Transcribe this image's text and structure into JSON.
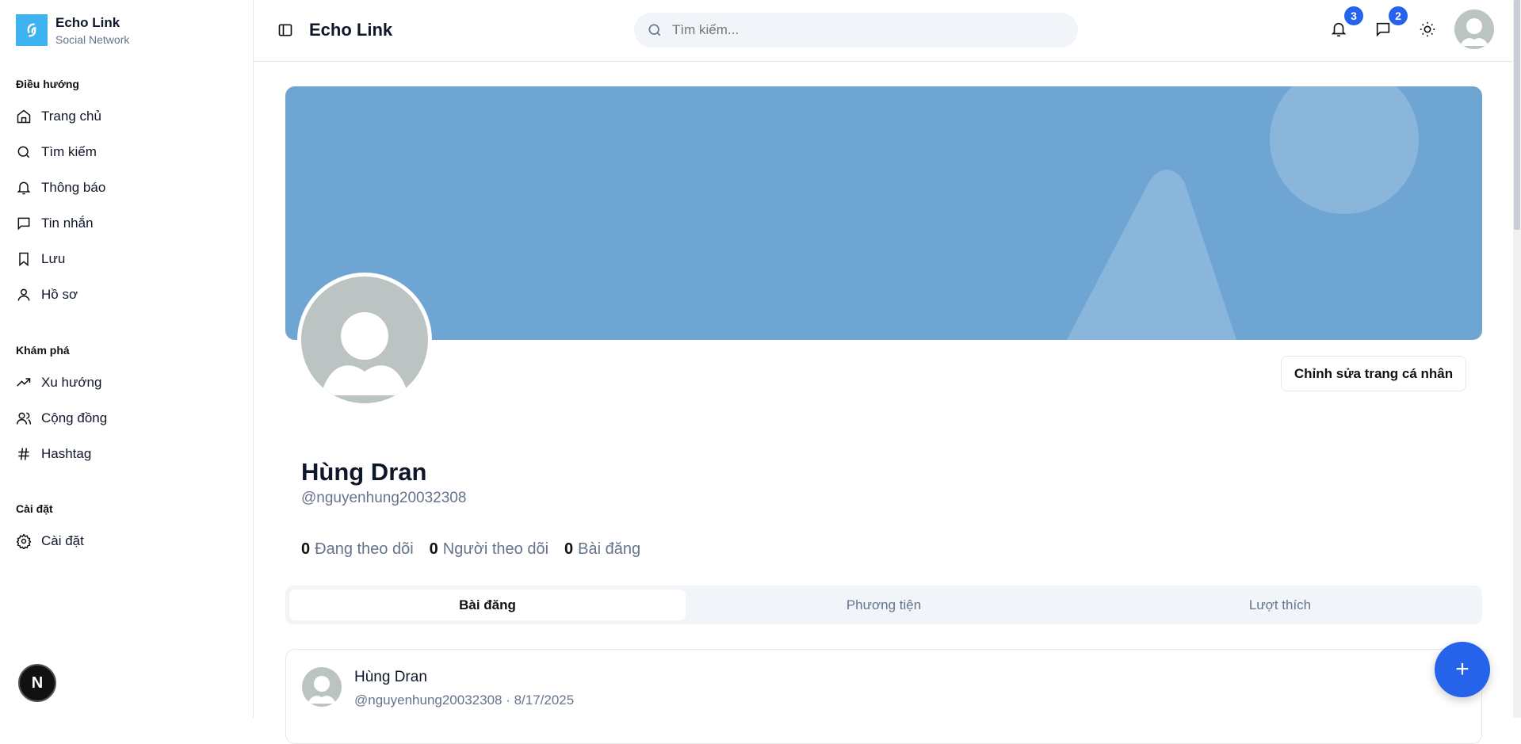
{
  "brand": {
    "title": "Echo Link",
    "subtitle": "Social Network"
  },
  "sidebar": {
    "groups": [
      {
        "label": "Điều hướng",
        "items": [
          {
            "label": "Trang chủ",
            "icon": "home-icon"
          },
          {
            "label": "Tìm kiếm",
            "icon": "search-icon"
          },
          {
            "label": "Thông báo",
            "icon": "bell-icon"
          },
          {
            "label": "Tin nhắn",
            "icon": "message-icon"
          },
          {
            "label": "Lưu",
            "icon": "bookmark-icon"
          },
          {
            "label": "Hồ sơ",
            "icon": "user-icon"
          }
        ]
      },
      {
        "label": "Khám phá",
        "items": [
          {
            "label": "Xu hướng",
            "icon": "trending-icon"
          },
          {
            "label": "Cộng đồng",
            "icon": "users-icon"
          },
          {
            "label": "Hashtag",
            "icon": "hash-icon"
          }
        ]
      },
      {
        "label": "Cài đặt",
        "items": [
          {
            "label": "Cài đặt",
            "icon": "gear-icon"
          }
        ]
      }
    ]
  },
  "header": {
    "title": "Echo Link",
    "search_placeholder": "Tìm kiếm...",
    "notifications_count": "3",
    "messages_count": "2"
  },
  "profile": {
    "name": "Hùng Dran",
    "handle": "@nguyenhung20032308",
    "edit_label": "Chỉnh sửa trang cá nhân",
    "stats": [
      {
        "value": "0",
        "label": "Đang theo dõi"
      },
      {
        "value": "0",
        "label": "Người theo dõi"
      },
      {
        "value": "0",
        "label": "Bài đăng"
      }
    ]
  },
  "tabs": [
    "Bài đăng",
    "Phương tiện",
    "Lượt thích"
  ],
  "post": {
    "author": "Hùng Dran",
    "meta": "@nguyenhung20032308 · 8/17/2025"
  },
  "fab_label": "+",
  "dev_badge": "N",
  "colors": {
    "accent": "#2563eb",
    "banner": "#6fa5d3",
    "logo": "#3db4f0"
  }
}
